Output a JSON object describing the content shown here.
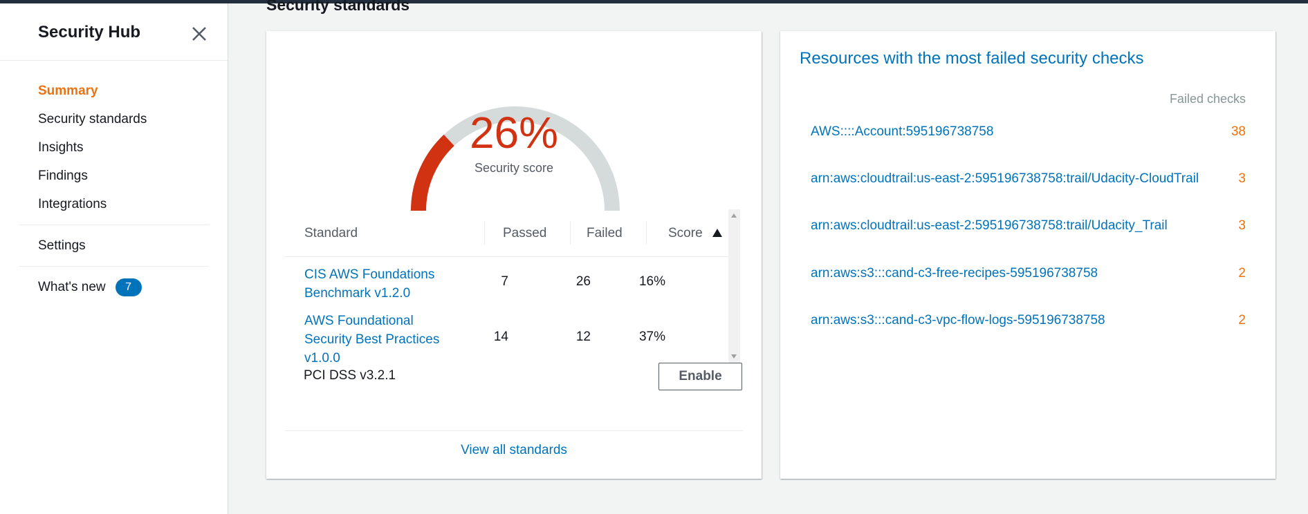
{
  "sidebar": {
    "title": "Security Hub",
    "close_icon": "close-icon",
    "items": [
      {
        "label": "Summary",
        "active": true
      },
      {
        "label": "Security standards"
      },
      {
        "label": "Insights"
      },
      {
        "label": "Findings"
      },
      {
        "label": "Integrations"
      }
    ],
    "settings_label": "Settings",
    "whats_new_label": "What's new",
    "whats_new_count": "7"
  },
  "main": {
    "section_heading": "Security standards",
    "score_card": {
      "score": "26%",
      "score_fraction": 0.26,
      "score_label": "Security score",
      "gauge_colors": {
        "fill": "#d13212",
        "track": "#d5dbdb"
      },
      "table": {
        "headers": {
          "standard": "Standard",
          "passed": "Passed",
          "failed": "Failed",
          "score": "Score"
        },
        "sort_icon": "sort-ascending-icon",
        "rows": [
          {
            "name_line1": "CIS AWS Foundations",
            "name_line2": "Benchmark v1.2.0",
            "name_line3": "",
            "passed": "7",
            "failed": "26",
            "score": "16%"
          },
          {
            "name_line1": "AWS Foundational",
            "name_line2": "Security Best Practices",
            "name_line3": "v1.0.0",
            "passed": "14",
            "failed": "12",
            "score": "37%"
          }
        ]
      },
      "pci": {
        "label": "PCI DSS v3.2.1",
        "button": "Enable"
      },
      "view_all": "View all standards"
    },
    "resources_card": {
      "title": "Resources with the most failed security checks",
      "col_head": "Failed checks",
      "rows": [
        {
          "resource": "AWS::::Account:595196738758",
          "count": "38"
        },
        {
          "resource": "arn:aws:cloudtrail:us-east-2:595196738758:trail/Udacity-CloudTrail",
          "count": "3"
        },
        {
          "resource": "arn:aws:cloudtrail:us-east-2:595196738758:trail/Udacity_Trail",
          "count": "3"
        },
        {
          "resource": "arn:aws:s3:::cand-c3-free-recipes-595196738758",
          "count": "2"
        },
        {
          "resource": "arn:aws:s3:::cand-c3-vpc-flow-logs-595196738758",
          "count": "2"
        }
      ]
    }
  }
}
